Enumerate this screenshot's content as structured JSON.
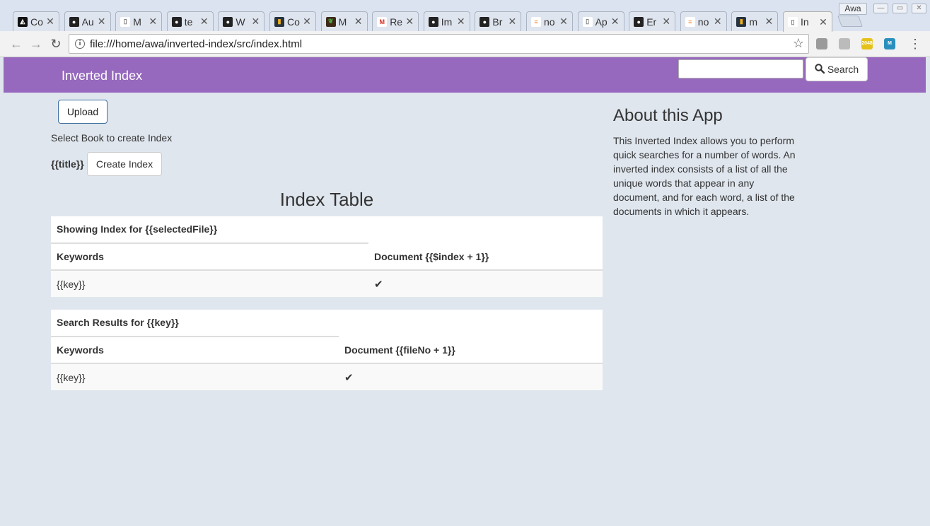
{
  "browser": {
    "tabs": [
      {
        "title": "Co",
        "icon": "codepen-icon"
      },
      {
        "title": "Au",
        "icon": "github-icon"
      },
      {
        "title": "M",
        "icon": "document-icon"
      },
      {
        "title": "te",
        "icon": "github-icon"
      },
      {
        "title": "W",
        "icon": "github-icon"
      },
      {
        "title": "Co",
        "icon": "codacy-icon"
      },
      {
        "title": "M",
        "icon": "mongodb-icon"
      },
      {
        "title": "Re",
        "icon": "gmail-icon"
      },
      {
        "title": "Im",
        "icon": "github-icon"
      },
      {
        "title": "Br",
        "icon": "github-icon"
      },
      {
        "title": "no",
        "icon": "stackoverflow-icon"
      },
      {
        "title": "Ap",
        "icon": "document-icon"
      },
      {
        "title": "Er",
        "icon": "github-icon"
      },
      {
        "title": "no",
        "icon": "stackoverflow-icon"
      },
      {
        "title": "m",
        "icon": "codacy-icon"
      },
      {
        "title": "In",
        "icon": "document-icon"
      }
    ],
    "profile": "Awa",
    "url": "file:///home/awa/inverted-index/src/index.html",
    "extensions": [
      {
        "label": "",
        "icon": "cloud-extension-icon",
        "color": "#9a9a9a"
      },
      {
        "label": "",
        "icon": "sync-extension-icon",
        "color": "#bbbbbb"
      },
      {
        "label": "2048",
        "icon": "2048-extension-icon",
        "color": "#e5c21a"
      },
      {
        "label": "M",
        "icon": "m-extension-icon",
        "color": "#2a8fbd"
      }
    ]
  },
  "app": {
    "brand": "Inverted Index",
    "search_button": "Search",
    "search_placeholder": "",
    "upload_button": "Upload",
    "select_label": "Select Book to create Index",
    "title_template": "{{title}}",
    "create_button": "Create Index",
    "index_heading": "Index Table",
    "index_table": {
      "caption": "Showing Index for {{selectedFile}}",
      "headers": [
        "Keywords",
        "Document {{$index + 1}}"
      ],
      "row": [
        "{{key}}",
        "✔"
      ]
    },
    "search_table": {
      "caption": "Search Results for {{key}}",
      "headers": [
        "Keywords",
        "Document {{fileNo + 1}}"
      ],
      "row": [
        "{{key}}",
        "✔"
      ]
    },
    "about": {
      "title": "About this App",
      "body": "This Inverted Index allows you to perform quick searches for a number of words. An inverted index consists of a list of all the unique words that appear in any document, and for each word, a list of the documents in which it appears."
    }
  },
  "colors": {
    "navbar": "#9669be",
    "page_bg": "#dfe6ee"
  }
}
